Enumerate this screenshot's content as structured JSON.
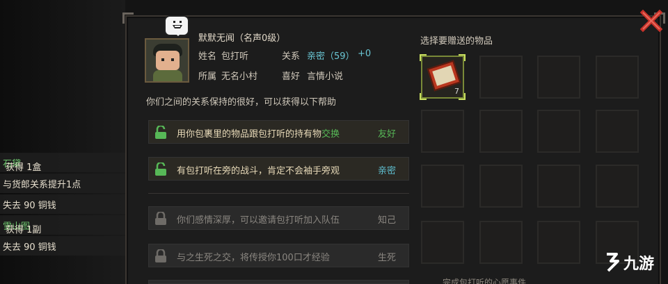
{
  "header": {
    "character_title": "默默无闻（名声0级）",
    "name_label": "姓名",
    "name_value": "包打听",
    "relation_label": "关系",
    "relation_value": "亲密（59）",
    "relation_delta": "+0",
    "faction_label": "所属",
    "faction_value": "无名小村",
    "hobby_label": "喜好",
    "hobby_value": "言情小说"
  },
  "description": "你们之间的关系保持的很好，可以获得以下帮助",
  "options": [
    {
      "text_prefix": "用你包裹里的物品跟包打听的持有物",
      "text_highlight": "交换",
      "tag": "友好",
      "status": "unlocked"
    },
    {
      "text_prefix": "有包打听在旁的战斗，肯定不会袖手旁观",
      "text_highlight": "",
      "tag": "亲密",
      "status": "unlocked"
    },
    {
      "text_prefix": "你们感情深厚，可以邀请包打听加入队伍",
      "text_highlight": "",
      "tag": "知己",
      "status": "locked"
    },
    {
      "text_prefix": "与之生死之交，将传授你100口才经验",
      "text_highlight": "",
      "tag": "生死",
      "status": "locked"
    }
  ],
  "gift_panel": {
    "title": "选择要赠送的物品",
    "selected_item": {
      "icon": "red-book-icon",
      "quantity": "7"
    }
  },
  "log": [
    {
      "prefix": "获得 1盒",
      "highlight": "石黛"
    },
    {
      "prefix": "与货郎关系提升1点",
      "highlight": ""
    },
    {
      "prefix": "失去 90 铜钱",
      "highlight": ""
    },
    {
      "prefix": "获得 1副",
      "highlight": "雪山图"
    },
    {
      "prefix": "失去 90 铜钱",
      "highlight": ""
    }
  ],
  "bottom_hint": "完成包打听的心愿事件",
  "watermark": "九游",
  "colors": {
    "accent_green": "#57b857",
    "accent_cyan": "#5fbfd0",
    "close_red": "#c8322a"
  }
}
